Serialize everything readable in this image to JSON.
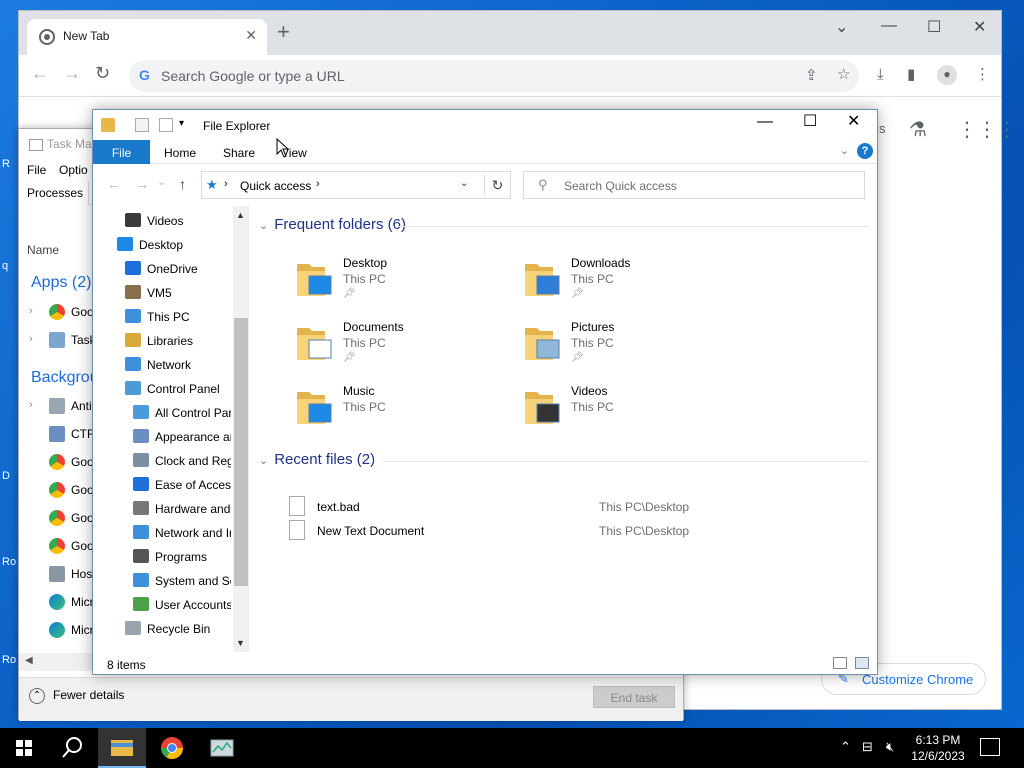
{
  "chrome": {
    "tab_title": "New Tab",
    "omnibox_placeholder": "Search Google or type a URL",
    "customize_label": "Customize Chrome",
    "partial_text": "s"
  },
  "taskmgr": {
    "title": "Task Ma",
    "menu": [
      "File",
      "Optio"
    ],
    "tab_processes": "Processes",
    "column_name": "Name",
    "group_apps": "Apps (2)",
    "group_background": "Backgrou",
    "app_rows": [
      "Goo",
      "Task"
    ],
    "bg_rows": [
      "Anti",
      "CTF",
      "Goo",
      "Goo",
      "Goo",
      "Goo",
      "Host",
      "Micr",
      "Micr"
    ],
    "fewer_details": "Fewer details",
    "end_task": "End task"
  },
  "explorer": {
    "title": "File Explorer",
    "ribbon": {
      "file": "File",
      "home": "Home",
      "share": "Share",
      "view": "View"
    },
    "address": "Quick access",
    "search_placeholder": "Search Quick access",
    "nav": [
      {
        "label": "Videos",
        "color": "#3a3a3a"
      },
      {
        "label": "Desktop",
        "color": "#1e88e5"
      },
      {
        "label": "OneDrive",
        "color": "#1e6fd9"
      },
      {
        "label": "VM5",
        "color": "#8a6d4b"
      },
      {
        "label": "This PC",
        "color": "#3c8fd8"
      },
      {
        "label": "Libraries",
        "color": "#d9a93a"
      },
      {
        "label": "Network",
        "color": "#3c8fd8"
      },
      {
        "label": "Control Panel",
        "color": "#4b9bd8"
      },
      {
        "label": "All Control Par",
        "color": "#4b9bd8"
      },
      {
        "label": "Appearance an",
        "color": "#6a8fc0"
      },
      {
        "label": "Clock and Regi",
        "color": "#7d8fa3"
      },
      {
        "label": "Ease of Access",
        "color": "#1e6fd9"
      },
      {
        "label": "Hardware and",
        "color": "#777777"
      },
      {
        "label": "Network and Ir",
        "color": "#3c8fd8"
      },
      {
        "label": "Programs",
        "color": "#555555"
      },
      {
        "label": "System and Sec",
        "color": "#3c8fd8"
      },
      {
        "label": "User Accounts",
        "color": "#4ca04c"
      },
      {
        "label": "Recycle Bin",
        "color": "#9aa3ad"
      }
    ],
    "frequent_title": "Frequent folders (6)",
    "folders": [
      {
        "name": "Desktop",
        "loc": "This PC",
        "pinned": true,
        "overlay": "#1e88e5"
      },
      {
        "name": "Downloads",
        "loc": "This PC",
        "pinned": true,
        "overlay": "#2f7fd8"
      },
      {
        "name": "Documents",
        "loc": "This PC",
        "pinned": true,
        "overlay": "#ffffff"
      },
      {
        "name": "Pictures",
        "loc": "This PC",
        "pinned": true,
        "overlay": "#8fb8d8"
      },
      {
        "name": "Music",
        "loc": "This PC",
        "pinned": false,
        "overlay": "#1e88e5"
      },
      {
        "name": "Videos",
        "loc": "This PC",
        "pinned": false,
        "overlay": "#333333"
      }
    ],
    "recent_title": "Recent files (2)",
    "recent": [
      {
        "name": "text.bad",
        "path": "This PC\\Desktop"
      },
      {
        "name": "New Text Document",
        "path": "This PC\\Desktop"
      }
    ],
    "status_count": "8 items"
  },
  "taskbar": {
    "time": "6:13 PM",
    "date": "12/6/2023"
  },
  "desktop": {
    "side_letters": [
      "R",
      "q",
      "D",
      "Ro",
      "Ro"
    ]
  }
}
